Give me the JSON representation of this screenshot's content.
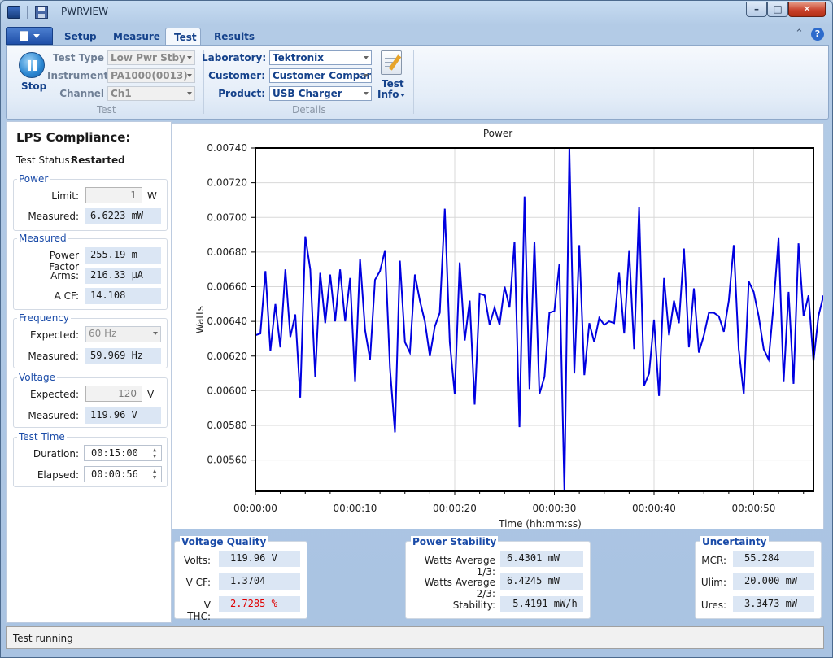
{
  "window": {
    "title": "PWRVIEW",
    "min": "–",
    "max": "□",
    "close": "✕"
  },
  "tabs": [
    "Setup",
    "Measure",
    "Test",
    "Results"
  ],
  "ribbon": {
    "stop_label": "Stop",
    "test_group": {
      "label": "Test",
      "fields": [
        {
          "label": "Test Type",
          "value": "Low Pwr Stby"
        },
        {
          "label": "Instrument",
          "value": "PA1000(0013)"
        },
        {
          "label": "Channel",
          "value": "Ch1"
        }
      ]
    },
    "details_group": {
      "label": "Details",
      "fields": [
        {
          "label": "Laboratory:",
          "value": "Tektronix"
        },
        {
          "label": "Customer:",
          "value": "Customer Compan"
        },
        {
          "label": "Product:",
          "value": "USB Charger"
        }
      ]
    },
    "test_info_label1": "Test",
    "test_info_label2": "Info"
  },
  "left": {
    "heading": "LPS Compliance:",
    "status_label": "Test Status:",
    "status_value": "Restarted",
    "power": {
      "title": "Power",
      "limit_label": "Limit:",
      "limit_value": "1",
      "limit_unit": "W",
      "measured_label": "Measured:",
      "measured_value": "6.6223 mW"
    },
    "measured": {
      "title": "Measured",
      "pf_label": "Power Factor",
      "pf_value": "255.19 m",
      "arms_label": "Arms:",
      "arms_value": "216.33 µA",
      "acf_label": "A CF:",
      "acf_value": "14.108"
    },
    "frequency": {
      "title": "Frequency",
      "expected_label": "Expected:",
      "expected_value": "60 Hz",
      "measured_label": "Measured:",
      "measured_value": "59.969 Hz"
    },
    "voltage": {
      "title": "Voltage",
      "expected_label": "Expected:",
      "expected_value": "120",
      "expected_unit": "V",
      "measured_label": "Measured:",
      "measured_value": "119.96 V"
    },
    "test_time": {
      "title": "Test Time",
      "duration_label": "Duration:",
      "duration_value": "00:15:00",
      "elapsed_label": "Elapsed:",
      "elapsed_value": "00:00:56"
    }
  },
  "chart_data": {
    "type": "line",
    "title": "Power",
    "xlabel": "Time (hh:mm:ss)",
    "ylabel": "Watts",
    "xlim": [
      0,
      56
    ],
    "ylim": [
      0.00542,
      0.0074
    ],
    "x_ticks": [
      "00:00:00",
      "00:00:10",
      "00:00:20",
      "00:00:30",
      "00:00:40",
      "00:00:50"
    ],
    "y_ticks": [
      "0.00740",
      "0.00720",
      "0.00700",
      "0.00680",
      "0.00660",
      "0.00640",
      "0.00620",
      "0.00600",
      "0.00580",
      "0.00560"
    ],
    "color": "#0000e0",
    "series": [
      {
        "x_step_seconds": 0.5,
        "values": [
          0.00632,
          0.00633,
          0.00669,
          0.00623,
          0.0065,
          0.00625,
          0.0067,
          0.00631,
          0.00644,
          0.00596,
          0.00689,
          0.0067,
          0.00608,
          0.00668,
          0.00639,
          0.00667,
          0.0064,
          0.0067,
          0.0064,
          0.00665,
          0.00605,
          0.00676,
          0.00635,
          0.00618,
          0.00664,
          0.00669,
          0.00681,
          0.00613,
          0.00576,
          0.00675,
          0.00628,
          0.00622,
          0.00667,
          0.00652,
          0.0064,
          0.0062,
          0.00637,
          0.00645,
          0.00705,
          0.00628,
          0.00598,
          0.00674,
          0.00629,
          0.00652,
          0.00592,
          0.00656,
          0.00655,
          0.00638,
          0.00648,
          0.00638,
          0.0066,
          0.00648,
          0.00686,
          0.00579,
          0.00712,
          0.00601,
          0.00686,
          0.00598,
          0.00608,
          0.00645,
          0.00646,
          0.00673,
          0.00542,
          0.0074,
          0.0061,
          0.00684,
          0.00609,
          0.00639,
          0.00628,
          0.00642,
          0.00638,
          0.0064,
          0.00639,
          0.00668,
          0.00633,
          0.00681,
          0.00624,
          0.00706,
          0.00603,
          0.0061,
          0.00641,
          0.00597,
          0.00665,
          0.00632,
          0.00652,
          0.00639,
          0.00682,
          0.00625,
          0.00659,
          0.00622,
          0.00632,
          0.00645,
          0.00645,
          0.00643,
          0.00634,
          0.00652,
          0.00684,
          0.00624,
          0.00598,
          0.00663,
          0.00657,
          0.00643,
          0.00624,
          0.00618,
          0.0065,
          0.00688,
          0.00605,
          0.00657,
          0.00604,
          0.00685,
          0.00643,
          0.00655,
          0.00617,
          0.00643,
          0.00655
        ]
      }
    ]
  },
  "bottom": {
    "voltage_quality": {
      "title": "Voltage Quality",
      "rows": [
        {
          "label": "Volts:",
          "value": "119.96 V"
        },
        {
          "label": "V CF:",
          "value": "1.3704"
        },
        {
          "label": "V THC:",
          "value": "2.7285 %"
        }
      ]
    },
    "power_stability": {
      "title": "Power Stability",
      "rows": [
        {
          "label": "Watts Average 1/3:",
          "value": "6.4301 mW"
        },
        {
          "label": "Watts Average 2/3:",
          "value": "6.4245 mW"
        },
        {
          "label": "Stability:",
          "value": "-5.4191 mW/h"
        }
      ]
    },
    "uncertainty": {
      "title": "Uncertainty",
      "rows": [
        {
          "label": "MCR:",
          "value": "55.284"
        },
        {
          "label": "Ulim:",
          "value": "20.000 mW"
        },
        {
          "label": "Ures:",
          "value": "3.3473 mW"
        }
      ]
    }
  },
  "status_text": "Test running",
  "colors": {
    "accent": "#15428b",
    "warn_text": "#e00000",
    "plot_line": "#0000e0"
  }
}
